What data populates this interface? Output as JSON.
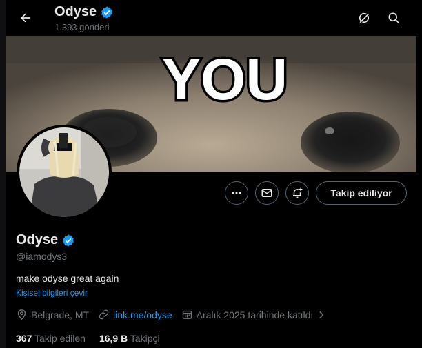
{
  "header": {
    "title": "Odyse",
    "post_count": "1.393 gönderi"
  },
  "banner": {
    "caption": "YOU"
  },
  "profile": {
    "display_name": "Odyse",
    "handle": "@iamodys3",
    "bio": "make odyse great again",
    "translate_link": "Kişisel bilgileri çevir",
    "location": "Belgrade, MT",
    "website": "link.me/odyse",
    "joined": "Aralık 2025 tarihinde katıldı",
    "follow_button": "Takip ediliyor",
    "following_count": "367",
    "following_label": "Takip edilen",
    "followers_count": "16,9 B",
    "followers_label": "Takipçi"
  },
  "colors": {
    "background": "#000000",
    "accent": "#1d9bf0",
    "muted": "#71767b",
    "border": "#536471"
  }
}
